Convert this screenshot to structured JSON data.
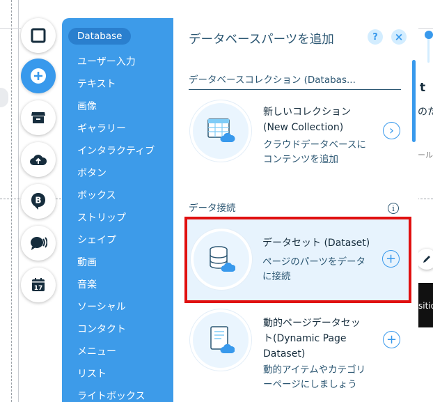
{
  "panel": {
    "title": "データベースパーツを追加",
    "help_label": "?",
    "close_label": "×"
  },
  "categories": [
    {
      "label": "Database",
      "selected": true
    },
    {
      "label": "ユーザー入力"
    },
    {
      "label": "テキスト"
    },
    {
      "label": "画像"
    },
    {
      "label": "ギャラリー"
    },
    {
      "label": "インタラクティブ"
    },
    {
      "label": "ボタン"
    },
    {
      "label": "ボックス"
    },
    {
      "label": "ストリップ"
    },
    {
      "label": "シェイプ"
    },
    {
      "label": "動画"
    },
    {
      "label": "音楽"
    },
    {
      "label": "ソーシャル"
    },
    {
      "label": "コンタクト"
    },
    {
      "label": "メニュー"
    },
    {
      "label": "リスト"
    },
    {
      "label": "ライトボックス"
    }
  ],
  "sections": {
    "collections": "データベースコレクション (Databas...",
    "data_connection": "データ接続"
  },
  "items": {
    "new_collection": {
      "title_line1": "新しいコレクション",
      "title_line2": "(New Collection)",
      "desc_line1": "クラウドデータベースに",
      "desc_line2": "コンテンツを追加",
      "action": "›"
    },
    "dataset": {
      "title": "データセット (Dataset)",
      "desc_line1": "ページのパーツをデータ",
      "desc_line2": "に接続",
      "action": "+"
    },
    "dynamic_dataset": {
      "title_line1": "動的ページデータセッ",
      "title_line2": "ト(Dynamic Page",
      "title_line3": "Dataset)",
      "desc_line1": "動的アイテムやカテゴリ",
      "desc_line2": "ーページにしましょう",
      "action": "+"
    }
  },
  "tools": [
    {
      "icon": "square-icon"
    },
    {
      "icon": "plus-icon",
      "active": true
    },
    {
      "icon": "store-icon"
    },
    {
      "icon": "cloud-upload-icon"
    },
    {
      "icon": "blog-icon",
      "label": "B"
    },
    {
      "icon": "chat-icon"
    },
    {
      "icon": "calendar-icon",
      "label": "17"
    }
  ],
  "background": {
    "peek_t": "t",
    "peek_tame": "のため",
    "peek_tool": "ール",
    "peek_dark": "sitio"
  },
  "colors": {
    "accent": "#3899ec",
    "category_bg": "#3d9be9",
    "highlight_border": "#e01010"
  }
}
